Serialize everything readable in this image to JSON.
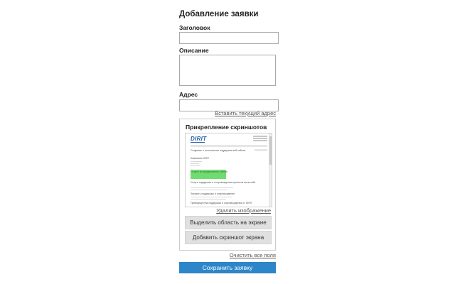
{
  "form": {
    "title": "Добавление заявки",
    "title_label": "Заголовок",
    "title_value": "",
    "description_label": "Описание",
    "description_value": "",
    "address_label": "Адрес",
    "address_value": "",
    "insert_address_link": "Вставить текущий адрес"
  },
  "screenshots": {
    "title": "Прикрепление скриншотов",
    "delete_link": "Удалить изображение",
    "select_area_button": "Выделить область на экране",
    "add_screenshot_button": "Добавить скриншот экрана",
    "thumbnail": {
      "logo": "DIRIT",
      "heading": "Создание и техническая поддержка веб-сайтов",
      "section1": "Компания DIRIT",
      "highlight": "Услуги по продвижению сайтов",
      "section2": "Услуги поддержки и сопровождения проектов всем сайт",
      "section3": "Заказать поддержку и сопровождение",
      "section4": "Преимущества поддержки и сопровождения от DIRIT"
    }
  },
  "actions": {
    "clear_link": "Очистить все поля",
    "save_button": "Сохранить заявку"
  },
  "colors": {
    "save_button": "#2d86c9",
    "highlight": "#6fdc6f",
    "gray_button": "#e0e0e0"
  }
}
